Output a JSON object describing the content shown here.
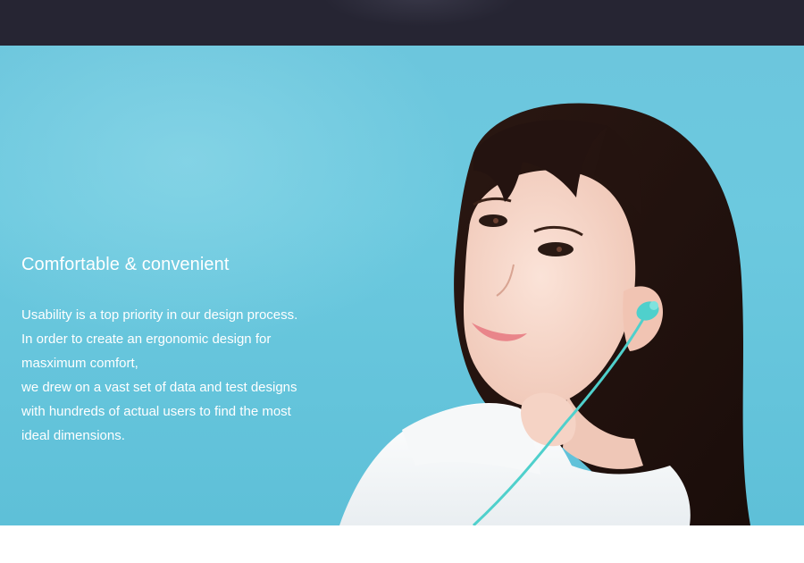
{
  "feature": {
    "title": "Comfortable & convenient",
    "lines": [
      "Usability is a top priority in our design process.",
      "In order to create an ergonomic design for",
      "masximum comfort,",
      "we drew on a vast set of data and test designs",
      "with hundreds of actual users to find the most",
      "ideal dimensions."
    ]
  },
  "colors": {
    "top_bar": "#262533",
    "banner_background": "#6cc6dd",
    "text": "#ffffff",
    "earphone": "#4fd0cc"
  }
}
